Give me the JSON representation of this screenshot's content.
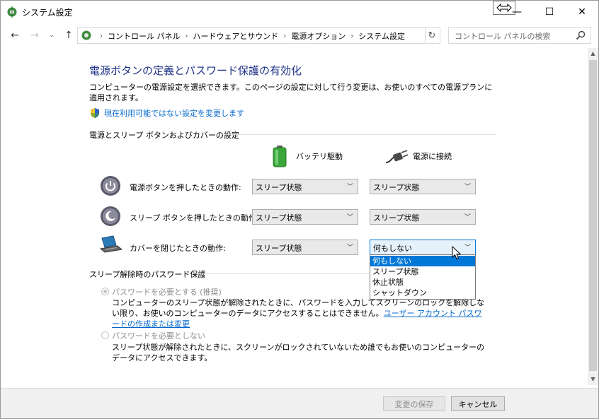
{
  "window": {
    "title": "システム設定"
  },
  "caption": {
    "minimize": "—",
    "maximize": "☐",
    "close": "✕"
  },
  "nav": {
    "back": "←",
    "forward": "→",
    "recent": "⌄",
    "up": "↑",
    "dropdown": "⌄",
    "refresh": "↻"
  },
  "address": {
    "crumbs": [
      "コントロール パネル",
      "ハードウェアとサウンド",
      "電源オプション",
      "システム設定"
    ],
    "separator": "›"
  },
  "search": {
    "placeholder": "コントロール パネルの検索"
  },
  "main": {
    "heading": "電源ボタンの定義とパスワード保護の有効化",
    "description": "コンピューターの電源設定を選択できます。このページの設定に対して行う変更は、お使いのすべての電源プランに適用されます。",
    "change_link": "現在利用可能ではない設定を変更します",
    "section_buttons": "電源とスリープ ボタンおよびカバーの設定",
    "col_battery": "バッテリ駆動",
    "col_plugged": "電源に接続",
    "rows": [
      {
        "label": "電源ボタンを押したときの動作:",
        "battery": "スリープ状態",
        "plugged": "スリープ状態"
      },
      {
        "label": "スリープ ボタンを押したときの動作:",
        "battery": "スリープ状態",
        "plugged": "スリープ状態"
      },
      {
        "label": "カバーを閉じたときの動作:",
        "battery": "スリープ状態",
        "plugged": "何もしない"
      }
    ],
    "dropdown_options": [
      "何もしない",
      "スリープ状態",
      "休止状態",
      "シャットダウン"
    ],
    "dropdown_selected_index": 0,
    "section_password": "スリープ解除時のパスワード保護",
    "require_pw": {
      "label": "パスワードを必要とする (推奨)",
      "desc": "コンピューターのスリープ状態が解除されたときに、パスワードを入力してスクリーンのロックを解除しない限り、お使いのコンピューターのデータにアクセスすることはできません。",
      "link": "ユーザー アカウント パスワードの作成または変更",
      "checked": true
    },
    "no_pw": {
      "label": "パスワードを必要としない",
      "desc": "スリープ状態が解除されたときに、スクリーンがロックされていないため誰でもお使いのコンピューターのデータにアクセスできます。",
      "checked": false
    }
  },
  "scrollbar": {
    "up": "▲",
    "down": "▼"
  },
  "footer": {
    "save": "変更の保存",
    "cancel": "キャンセル"
  },
  "colors": {
    "heading": "#1e3287",
    "link": "#0066cc",
    "selection": "#0078d7"
  }
}
